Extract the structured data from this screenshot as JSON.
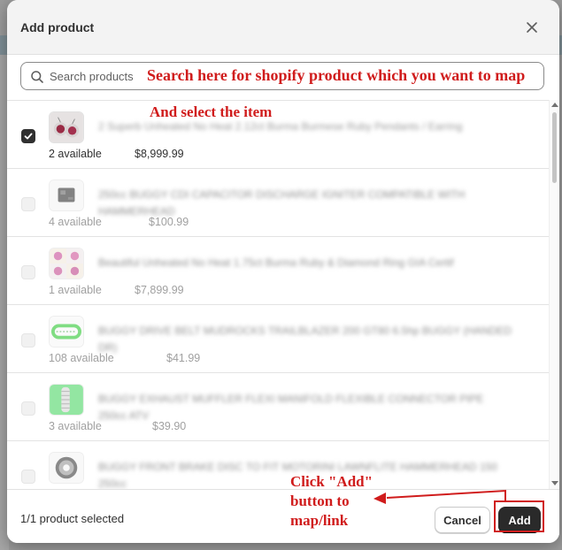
{
  "modal": {
    "title": "Add product",
    "close_icon": "close-icon"
  },
  "search": {
    "placeholder": "Search products",
    "value": ""
  },
  "annotations": {
    "search_hint": "Search here for shopify product which you want to map",
    "select_hint": "And select the item",
    "add_hint": "Click \"Add\" button to map/link",
    "color": "#d01c1c"
  },
  "products": [
    {
      "title": "2 Superb Unheated No Heat 2.12ct Burma Burmese Ruby Pendants / Earring",
      "available": "2 available",
      "price": "$8,999.99",
      "selected": true,
      "enabled": true,
      "image": "ruby-pendants"
    },
    {
      "title": "250cc BUGGY CDI CAPACITOR DISCHARGE IGNITER COMPATIBLE WITH HAMMERHEAD",
      "available": "4 available",
      "price": "$100.99",
      "selected": false,
      "enabled": false,
      "image": "cdi-unit"
    },
    {
      "title": "Beautiful Unheated No Heat 1.75ct Burma Ruby & Diamond Ring GIA Certif",
      "available": "1 available",
      "price": "$7,899.99",
      "selected": false,
      "enabled": false,
      "image": "ruby-ring"
    },
    {
      "title": "BUGGY DRIVE BELT MUDROCKS TRAILBLAZER 200 GT80 6.5hp BUGGY (HANDED DR)",
      "available": "108 available",
      "price": "$41.99",
      "selected": false,
      "enabled": false,
      "image": "drive-belt"
    },
    {
      "title": "BUGGY EXHAUST MUFFLER FLEXI MANIFOLD FLEXIBLE CONNECTOR PIPE 250cc ATV",
      "available": "3 available",
      "price": "$39.90",
      "selected": false,
      "enabled": false,
      "image": "exhaust-pipe"
    },
    {
      "title": "BUGGY FRONT BRAKE DISC TO FIT MOTORINI LAWNFLITE HAMMERHEAD 150 250cc",
      "available": "",
      "price": "",
      "selected": false,
      "enabled": false,
      "image": "brake-disc"
    }
  ],
  "footer": {
    "selected_text": "1/1 product selected",
    "cancel_label": "Cancel",
    "add_label": "Add"
  },
  "colors": {
    "primary_button": "#2a2a2a",
    "annotation": "#d01c1c"
  }
}
